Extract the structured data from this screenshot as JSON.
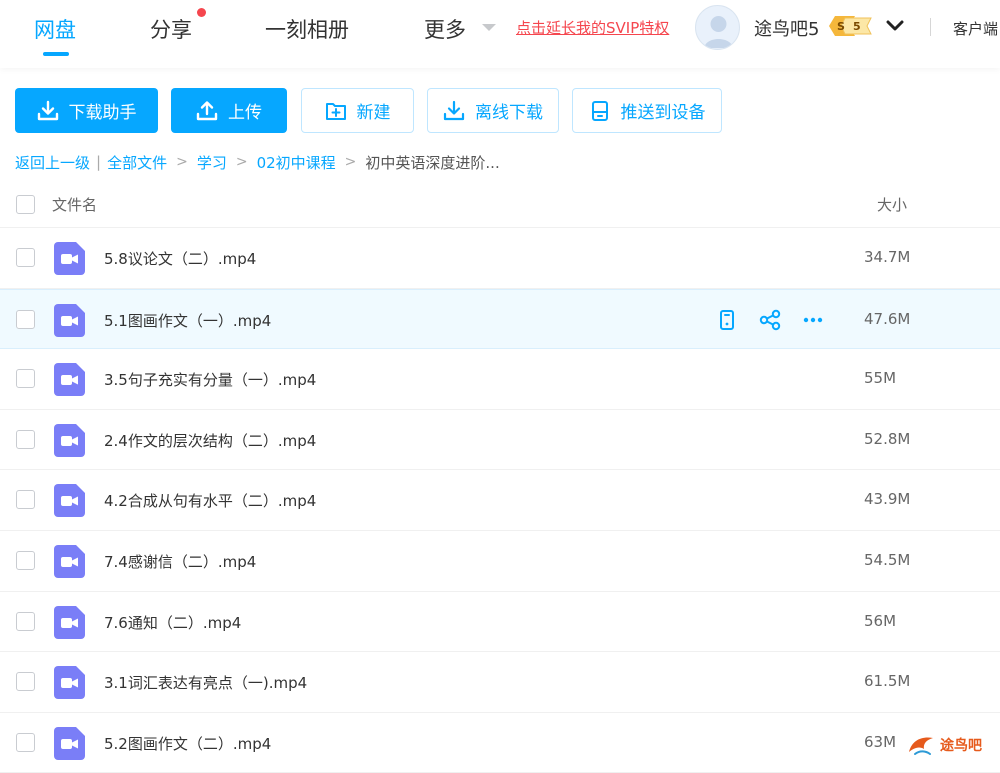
{
  "nav": {
    "tabs": [
      {
        "label": "网盘",
        "active": true
      },
      {
        "label": "分享",
        "has_dot": true
      },
      {
        "label": "一刻相册"
      },
      {
        "label": "更多"
      }
    ],
    "svip_link": "点击延长我的SVIP特权",
    "username": "途鸟吧5",
    "vip_level": "5",
    "vip_badge_letter": "S",
    "client_label": "客户端"
  },
  "toolbar": {
    "download_helper": "下载助手",
    "upload": "上传",
    "new_folder": "新建",
    "offline_download": "离线下载",
    "push_to_device": "推送到设备"
  },
  "breadcrumb": {
    "back": "返回上一级",
    "items": [
      "全部文件",
      "学习",
      "02初中课程"
    ],
    "current": "初中英语深度进阶..."
  },
  "list": {
    "header_name": "文件名",
    "header_size": "大小",
    "files": [
      {
        "name": "5.8议论文（二）.mp4",
        "size": "34.7M"
      },
      {
        "name": "5.1图画作文（一）.mp4",
        "size": "47.6M",
        "hovered": true
      },
      {
        "name": "3.5句子充实有分量（一）.mp4",
        "size": "55M"
      },
      {
        "name": "2.4作文的层次结构（二）.mp4",
        "size": "52.8M"
      },
      {
        "name": "4.2合成从句有水平（二）.mp4",
        "size": "43.9M"
      },
      {
        "name": "7.4感谢信（二）.mp4",
        "size": "54.5M"
      },
      {
        "name": "7.6通知（二）.mp4",
        "size": "56M"
      },
      {
        "name": "3.1词汇表达有亮点（一).mp4",
        "size": "61.5M"
      },
      {
        "name": "5.2图画作文（二）.mp4",
        "size": "63M"
      }
    ]
  },
  "watermark": {
    "text": "途鸟吧"
  },
  "colors": {
    "accent": "#06a7ff",
    "video_icon": "#7a7ef7",
    "alert": "#f5464e"
  }
}
